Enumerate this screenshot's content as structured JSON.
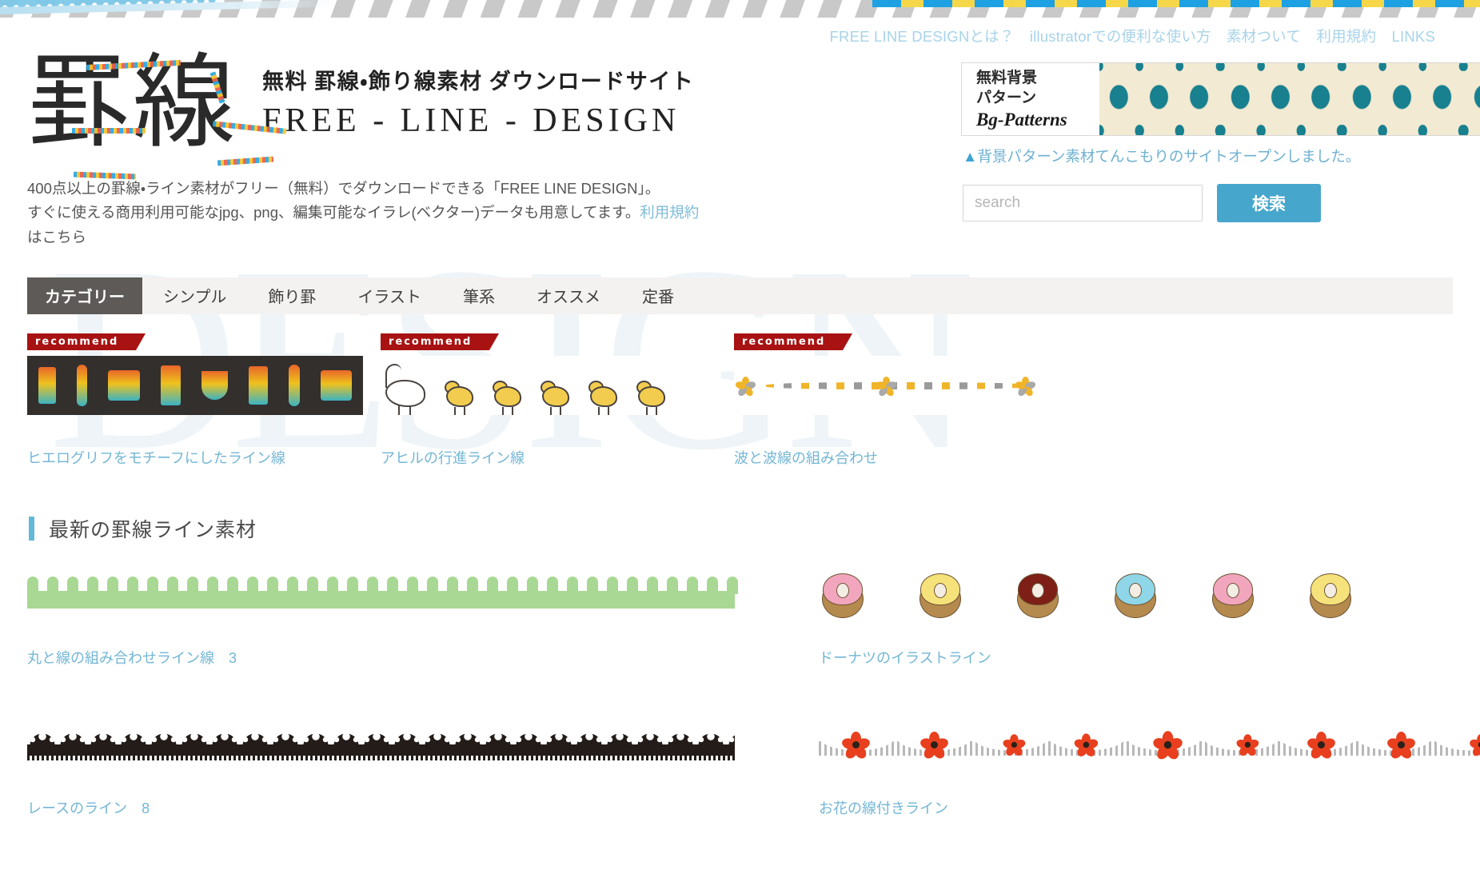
{
  "colors": {
    "accent_blue": "#46a6cc",
    "link_blue": "#73b6d4",
    "nav_active": "#5d5a57",
    "nav_bg": "#f4f2f0",
    "badge_red": "#a81212",
    "banner_teal": "#18808f",
    "banner_cream": "#f2ead2",
    "green_line": "#a8d893",
    "flower_red": "#e8401f"
  },
  "topnav": {
    "items": [
      {
        "label": "FREE LINE DESIGNとは？"
      },
      {
        "label": "illustratorでの便利な使い方"
      },
      {
        "label": "素材ついて"
      },
      {
        "label": "利用規約"
      },
      {
        "label": "LINKS"
      }
    ]
  },
  "logo": {
    "mark": "罫線",
    "tagline_jp": "無料 罫線・飾り線素材 ダウンロードサイト",
    "tagline_en": "FREE - LINE - DESIGN"
  },
  "lead": {
    "line1": "400点以上の罫線・ライン素材がフリー（無料）でダウンロードできる「FREE LINE DESIGN」。",
    "line2": "すぐに使える商用利用可能なjpg、png、編集可能なイラレ(ベクター)データも用意してます。",
    "link": "利用規約",
    "line3": "はこちら"
  },
  "banner": {
    "label_line1": "無料背景",
    "label_line2": "パターン",
    "label_line3": "Bg-Patterns",
    "note_triangle": "▲",
    "note": "背景パターン素材てんこもりのサイトオープンしました。"
  },
  "search": {
    "placeholder": "search",
    "value": "",
    "button_label": "検索"
  },
  "catnav": {
    "label": "カテゴリー",
    "items": [
      {
        "label": "シンプル"
      },
      {
        "label": "飾り罫"
      },
      {
        "label": "イラスト"
      },
      {
        "label": "筆系"
      },
      {
        "label": "オススメ"
      },
      {
        "label": "定番"
      }
    ]
  },
  "recommend": {
    "badge_label": "recommend",
    "cards": [
      {
        "caption": "ヒエログリフをモチーフにしたライン線"
      },
      {
        "caption": "アヒルの行進ライン線"
      },
      {
        "caption": "波と波線の組み合わせ"
      }
    ]
  },
  "latest": {
    "section_title": "最新の罫線ライン素材",
    "items": [
      {
        "caption": "丸と線の組み合わせライン線　3"
      },
      {
        "caption": "ドーナツのイラストライン"
      },
      {
        "caption": "レースのライン　8"
      },
      {
        "caption": "お花の線付きライン"
      }
    ],
    "donut_icings": [
      "#f2a6bd",
      "#f6e27a",
      "#7d1f17",
      "#8fd6e8",
      "#f2a6bd",
      "#f6e27a"
    ]
  },
  "watermark": {
    "text": "DESIGN"
  },
  "icons": {
    "triangle": "triangle-up-icon",
    "search": "search-icon"
  }
}
